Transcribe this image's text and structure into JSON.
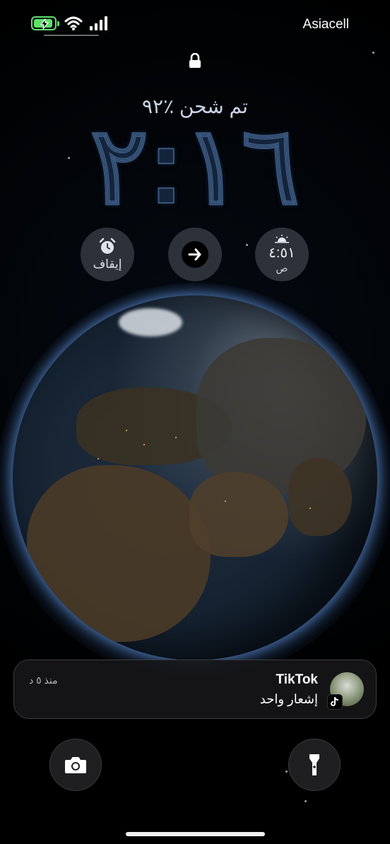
{
  "status_bar": {
    "carrier": "Asiacell",
    "battery_level": 0.92,
    "battery_icon": "battery-charging-icon",
    "wifi_icon": "wifi-icon",
    "signal_icon": "cellular-signal-icon"
  },
  "lock_icon": "lock-icon",
  "charging_text": "تم شحن ٪٩٢",
  "clock": "٢:١٦",
  "widgets": {
    "alarm": {
      "icon": "alarm-clock-icon",
      "label": "إيقاف"
    },
    "shortcut": {
      "icon": "arrow-right-icon"
    },
    "sunrise": {
      "icon": "sunrise-icon",
      "time": "٤:٥١",
      "sub": "ص"
    }
  },
  "notification": {
    "app": "TikTok",
    "message": "إشعار واحد",
    "time": "منذ ٥ د",
    "avatar_icon": "avatar",
    "badge_icon": "tiktok-icon"
  },
  "bottom_actions": {
    "flashlight": {
      "icon": "flashlight-icon"
    },
    "camera": {
      "icon": "camera-icon"
    }
  },
  "colors": {
    "battery_green": "#5de06a",
    "clock_fill": "#14243b",
    "clock_stroke": "#3a577e",
    "widget_bg": "#3a3e46"
  }
}
